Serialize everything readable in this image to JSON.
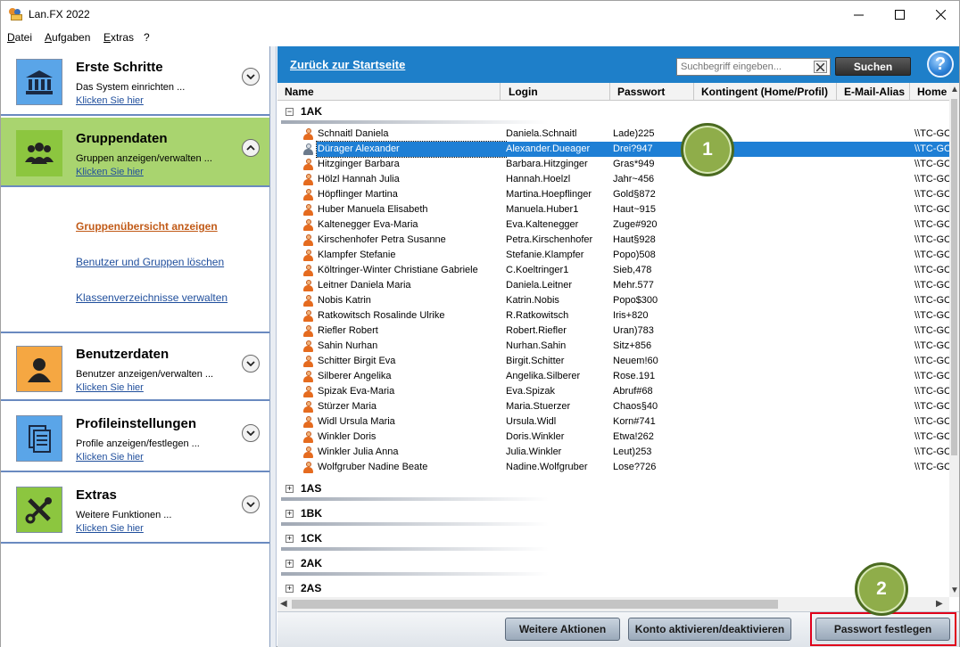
{
  "window": {
    "title": "Lan.FX 2022",
    "controls": {
      "minimize": "—",
      "maximize": "☐",
      "close": "✕"
    }
  },
  "menu": {
    "items": [
      {
        "accel": "D",
        "rest": "atei"
      },
      {
        "accel": "A",
        "rest": "ufgaben"
      },
      {
        "accel": "E",
        "rest": "xtras"
      },
      {
        "accel": "",
        "rest": "?"
      }
    ]
  },
  "sidebar": {
    "sections": [
      {
        "title": "Erste Schritte",
        "subtitle": "Das System einrichten ...",
        "link": "Klicken Sie hier",
        "icon": "bank-icon",
        "toggle": "chevron-down",
        "active": false
      },
      {
        "title": "Gruppendaten",
        "subtitle": "Gruppen anzeigen/verwalten ...",
        "link": "Klicken Sie hier",
        "icon": "group-icon",
        "toggle": "chevron-up",
        "active": true
      },
      {
        "title": "Benutzerdaten",
        "subtitle": "Benutzer anzeigen/verwalten ...",
        "link": "Klicken Sie hier",
        "icon": "user-icon",
        "toggle": "chevron-down",
        "active": false
      },
      {
        "title": "Profileinstellungen",
        "subtitle": "Profile anzeigen/festlegen ...",
        "link": "Klicken Sie hier",
        "icon": "profile-icon",
        "toggle": "chevron-down",
        "active": false
      },
      {
        "title": "Extras",
        "subtitle": "Weitere Funktionen ...",
        "link": "Klicken Sie hier",
        "icon": "tools-icon",
        "toggle": "chevron-down",
        "active": false
      }
    ],
    "sublinks": [
      {
        "label": "Gruppenübersicht anzeigen",
        "active": true
      },
      {
        "label": "Benutzer und Gruppen löschen",
        "active": false
      },
      {
        "label": "Klassenverzeichnisse verwalten",
        "active": false
      }
    ]
  },
  "topbar": {
    "back_link": "Zurück zur Startseite",
    "search_placeholder": "Suchbegriff eingeben...",
    "search_button": "Suchen",
    "help": "?"
  },
  "table": {
    "columns": [
      "Name",
      "Login",
      "Passwort",
      "Kontingent (Home/Profil)",
      "E-Mail-Alias",
      "Home"
    ],
    "groups": [
      {
        "name": "1AK",
        "expanded": true,
        "toggle": "−",
        "rows": [
          {
            "name": "Schnaitl Daniela",
            "login": "Daniela.Schnaitl",
            "password": "Lade)225",
            "home": "\\\\TC-GC"
          },
          {
            "name": "Dürager Alexander",
            "login": "Alexander.Dueager",
            "password": "Drei?947",
            "home": "\\\\TC-GC",
            "selected": true
          },
          {
            "name": "Hitzginger Barbara",
            "login": "Barbara.Hitzginger",
            "password": "Gras*949",
            "home": "\\\\TC-GC"
          },
          {
            "name": "Hölzl Hannah Julia",
            "login": "Hannah.Hoelzl",
            "password": "Jahr~456",
            "home": "\\\\TC-GC"
          },
          {
            "name": "Höpflinger Martina",
            "login": "Martina.Hoepflinger",
            "password": "Gold§872",
            "home": "\\\\TC-GC"
          },
          {
            "name": "Huber Manuela Elisabeth",
            "login": "Manuela.Huber1",
            "password": "Haut~915",
            "home": "\\\\TC-GC"
          },
          {
            "name": "Kaltenegger Eva-Maria",
            "login": "Eva.Kaltenegger",
            "password": "Zuge#920",
            "home": "\\\\TC-GC"
          },
          {
            "name": "Kirschenhofer Petra Susanne",
            "login": "Petra.Kirschenhofer",
            "password": "Haut§928",
            "home": "\\\\TC-GC"
          },
          {
            "name": "Klampfer Stefanie",
            "login": "Stefanie.Klampfer",
            "password": "Popo)508",
            "home": "\\\\TC-GC"
          },
          {
            "name": "Költringer-Winter Christiane Gabriele",
            "login": "C.Koeltringer1",
            "password": "Sieb,478",
            "home": "\\\\TC-GC"
          },
          {
            "name": "Leitner Daniela Maria",
            "login": "Daniela.Leitner",
            "password": "Mehr.577",
            "home": "\\\\TC-GC"
          },
          {
            "name": "Nobis Katrin",
            "login": "Katrin.Nobis",
            "password": "Popo$300",
            "home": "\\\\TC-GC"
          },
          {
            "name": "Ratkowitsch Rosalinde Ulrike",
            "login": "R.Ratkowitsch",
            "password": "Iris+820",
            "home": "\\\\TC-GC"
          },
          {
            "name": "Riefler Robert",
            "login": "Robert.Riefler",
            "password": "Uran)783",
            "home": "\\\\TC-GC"
          },
          {
            "name": "Sahin Nurhan",
            "login": "Nurhan.Sahin",
            "password": "Sitz+856",
            "home": "\\\\TC-GC"
          },
          {
            "name": "Schitter Birgit Eva",
            "login": "Birgit.Schitter",
            "password": "Neuem!60",
            "home": "\\\\TC-GC"
          },
          {
            "name": "Silberer Angelika",
            "login": "Angelika.Silberer",
            "password": "Rose.191",
            "home": "\\\\TC-GC"
          },
          {
            "name": "Spizak Eva-Maria",
            "login": "Eva.Spizak",
            "password": "Abruf#68",
            "home": "\\\\TC-GC"
          },
          {
            "name": "Stürzer Maria",
            "login": "Maria.Stuerzer",
            "password": "Chaos§40",
            "home": "\\\\TC-GC"
          },
          {
            "name": "Widl Ursula Maria",
            "login": "Ursula.Widl",
            "password": "Korn#741",
            "home": "\\\\TC-GC"
          },
          {
            "name": "Winkler Doris",
            "login": "Doris.Winkler",
            "password": "Etwa!262",
            "home": "\\\\TC-GC"
          },
          {
            "name": "Winkler Julia Anna",
            "login": "Julia.Winkler",
            "password": "Leut)253",
            "home": "\\\\TC-GC"
          },
          {
            "name": "Wolfgruber Nadine Beate",
            "login": "Nadine.Wolfgruber",
            "password": "Lose?726",
            "home": "\\\\TC-GC"
          }
        ]
      },
      {
        "name": "1AS",
        "expanded": false,
        "toggle": "+",
        "rows": []
      },
      {
        "name": "1BK",
        "expanded": false,
        "toggle": "+",
        "rows": []
      },
      {
        "name": "1CK",
        "expanded": false,
        "toggle": "+",
        "rows": []
      },
      {
        "name": "2AK",
        "expanded": false,
        "toggle": "+",
        "rows": []
      },
      {
        "name": "2AS",
        "expanded": false,
        "toggle": "+",
        "rows": []
      }
    ]
  },
  "actions": {
    "more": "Weitere Aktionen",
    "toggle_account": "Konto aktivieren/deaktivieren",
    "set_password": "Passwort festlegen"
  },
  "callouts": [
    "1",
    "2"
  ],
  "colors": {
    "accent_blue": "#1e7fc9",
    "active_green": "#a9d46f",
    "callout_green": "#8fad4a",
    "highlight_red": "#e0001b"
  }
}
